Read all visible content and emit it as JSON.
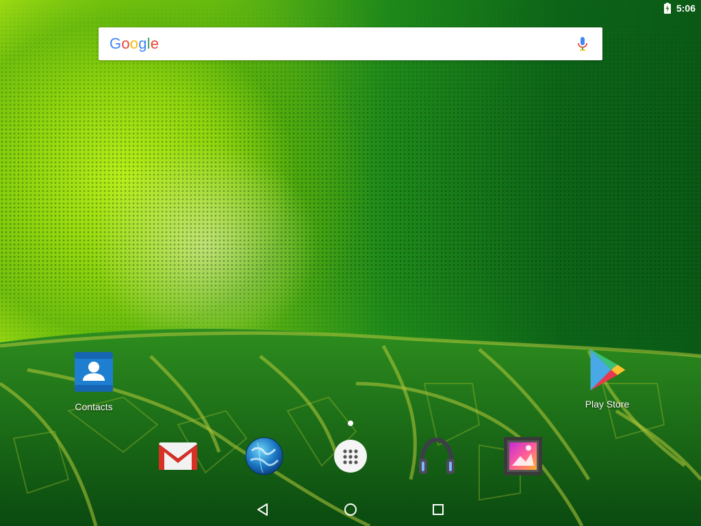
{
  "status_bar": {
    "time": "5:06",
    "battery_icon": "battery-charging-icon"
  },
  "search": {
    "logo_letters": [
      "G",
      "o",
      "o",
      "g",
      "l",
      "e"
    ],
    "logo_colors": [
      "#4285F4",
      "#EA4335",
      "#FBBC05",
      "#4285F4",
      "#34A853",
      "#EA4335"
    ],
    "mic_icon": "mic-icon"
  },
  "desktop_apps": [
    {
      "label": "Contacts",
      "icon": "contacts-icon"
    },
    {
      "label": "Play Store",
      "icon": "play-store-icon"
    }
  ],
  "dock": [
    {
      "icon": "gmail-icon"
    },
    {
      "icon": "browser-globe-icon"
    },
    {
      "icon": "app-drawer-icon"
    },
    {
      "icon": "music-headphones-icon"
    },
    {
      "icon": "gallery-icon"
    }
  ],
  "nav": {
    "back_icon": "back-icon",
    "home_icon": "home-icon",
    "recents_icon": "recents-icon"
  }
}
